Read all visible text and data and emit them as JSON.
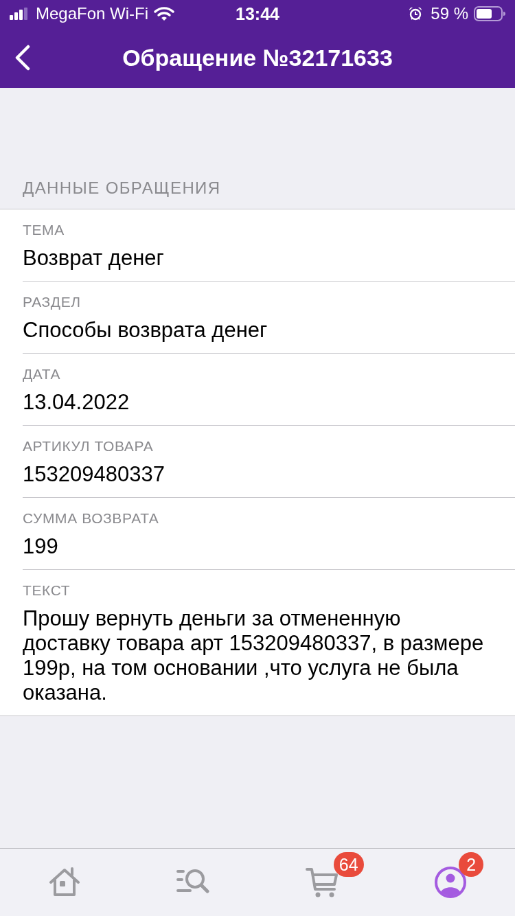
{
  "status_bar": {
    "carrier": "MegaFon Wi-Fi",
    "time": "13:44",
    "battery": "59 %"
  },
  "nav_bar": {
    "title": "Обращение №32171633"
  },
  "section": {
    "header": "ДАННЫЕ ОБРАЩЕНИЯ",
    "fields": [
      {
        "label": "ТЕМА",
        "value": "Возврат денег"
      },
      {
        "label": "РАЗДЕЛ",
        "value": "Способы возврата денег"
      },
      {
        "label": "ДАТА",
        "value": "13.04.2022"
      },
      {
        "label": "АРТИКУЛ ТОВАРА",
        "value": "153209480337"
      },
      {
        "label": "СУММА ВОЗВРАТА",
        "value": "199"
      },
      {
        "label": "ТЕКСТ",
        "value": "Прошу вернуть деньги за отмененную доставку товара арт 153209480337, в размере 199р, на том основании ,что услуга не была оказана."
      }
    ]
  },
  "tab_bar": {
    "items": [
      {
        "kind": "home",
        "selected": false
      },
      {
        "kind": "search",
        "selected": false
      },
      {
        "kind": "cart",
        "selected": false,
        "badge": "64"
      },
      {
        "kind": "profile",
        "selected": true,
        "badge": "2"
      }
    ]
  }
}
